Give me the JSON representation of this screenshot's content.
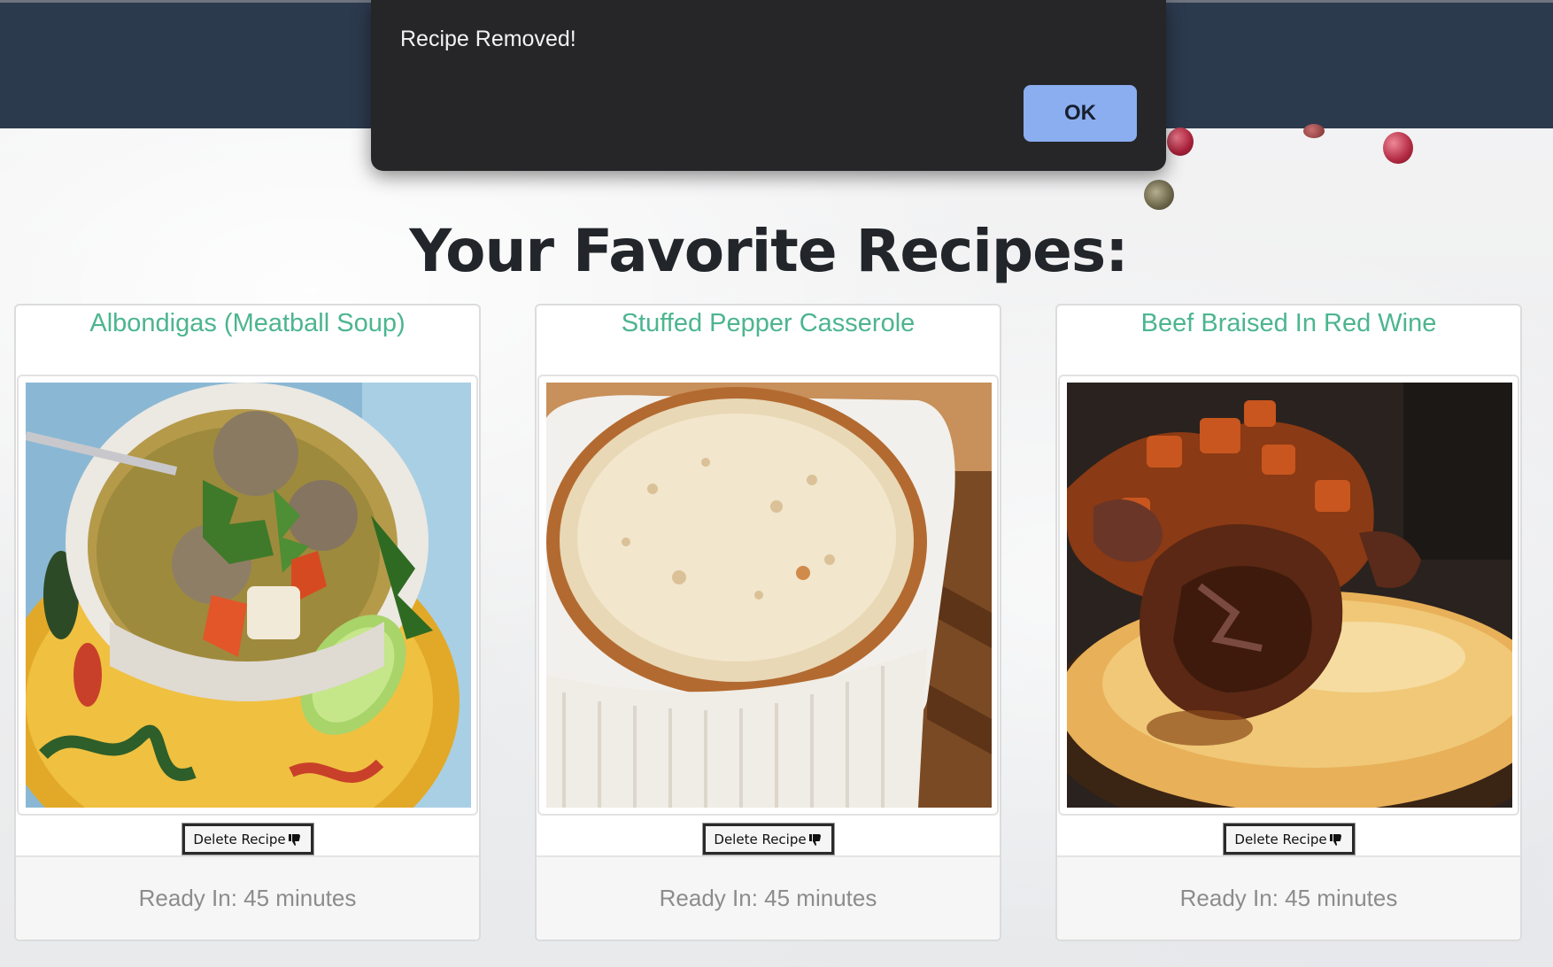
{
  "page": {
    "title": "Your Favorite Recipes:"
  },
  "alert": {
    "message": "Recipe Removed!",
    "ok_label": "OK"
  },
  "recipes": [
    {
      "title": "Albondigas (Meatball Soup)",
      "delete_label": "Delete Recipe",
      "ready": "Ready In: 45 minutes"
    },
    {
      "title": "Stuffed Pepper Casserole",
      "delete_label": "Delete Recipe",
      "ready": "Ready In: 45 minutes"
    },
    {
      "title": "Beef Braised In Red Wine",
      "delete_label": "Delete Recipe",
      "ready": "Ready In: 45 minutes"
    }
  ],
  "icons": {
    "delete": "thumbs-down-icon"
  },
  "colors": {
    "navbar": "#2c3a4e",
    "recipe_title": "#4cb58f",
    "ok_button": "#8aaef0",
    "alert_bg": "#262628"
  }
}
